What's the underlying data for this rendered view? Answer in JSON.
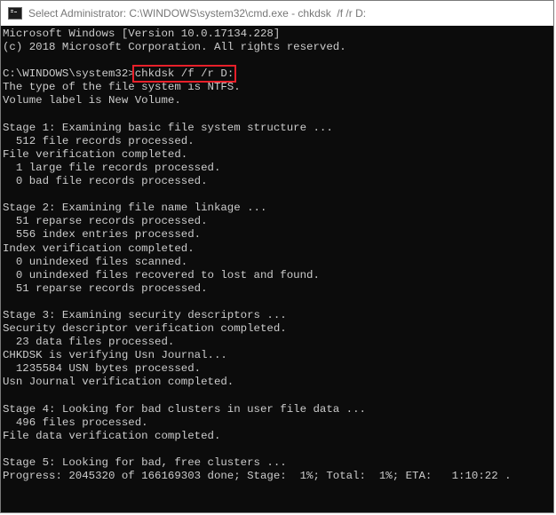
{
  "window": {
    "title": "Select Administrator: C:\\WINDOWS\\system32\\cmd.exe - chkdsk  /f /r D:",
    "icon": "cmd-icon"
  },
  "colors": {
    "console_bg": "#0c0c0c",
    "console_text": "#cccccc",
    "highlight_border": "#e8202a"
  },
  "console": {
    "lines": [
      "Microsoft Windows [Version 10.0.17134.228]",
      "(c) 2018 Microsoft Corporation. All rights reserved.",
      "",
      "",
      "The type of the file system is NTFS.",
      "Volume label is New Volume.",
      "",
      "Stage 1: Examining basic file system structure ...",
      "  512 file records processed.",
      "File verification completed.",
      "  1 large file records processed.",
      "  0 bad file records processed.",
      "",
      "Stage 2: Examining file name linkage ...",
      "  51 reparse records processed.",
      "  556 index entries processed.",
      "Index verification completed.",
      "  0 unindexed files scanned.",
      "  0 unindexed files recovered to lost and found.",
      "  51 reparse records processed.",
      "",
      "Stage 3: Examining security descriptors ...",
      "Security descriptor verification completed.",
      "  23 data files processed.",
      "CHKDSK is verifying Usn Journal...",
      "  1235584 USN bytes processed.",
      "Usn Journal verification completed.",
      "",
      "Stage 4: Looking for bad clusters in user file data ...",
      "  496 files processed.",
      "File data verification completed.",
      "",
      "Stage 5: Looking for bad, free clusters ...",
      "Progress: 2045320 of 166169303 done; Stage:  1%; Total:  1%; ETA:   1:10:22 ."
    ],
    "prompt": "C:\\WINDOWS\\system32>",
    "command": "chkdsk /f /r D:"
  }
}
